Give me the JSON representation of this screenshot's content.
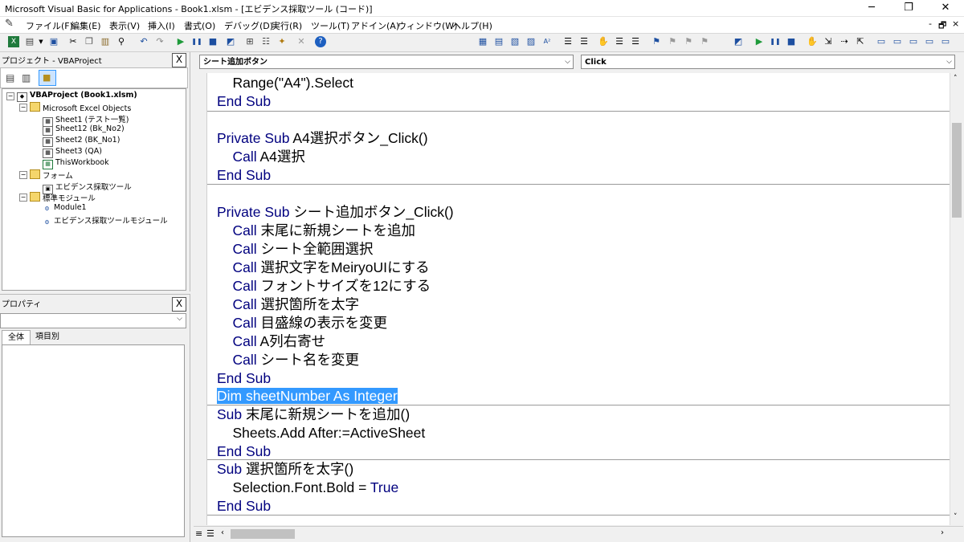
{
  "window": {
    "title": "Microsoft Visual Basic for Applications - Book1.xlsm - [エビデンス採取ツール (コード)]",
    "minimize": "─",
    "maximize": "❐",
    "close": "✕"
  },
  "menu": {
    "items": [
      "ファイル(F)",
      "編集(E)",
      "表示(V)",
      "挿入(I)",
      "書式(O)",
      "デバッグ(D)",
      "実行(R)",
      "ツール(T)",
      "アドイン(A)",
      "ウィンドウ(W)",
      "ヘルプ(H)"
    ],
    "mdi_minimize": "-",
    "mdi_restore": "🗗",
    "mdi_close": "×"
  },
  "project_pane": {
    "title": "プロジェクト - VBAProject",
    "close": "X",
    "tree": [
      {
        "label": "VBAProject (Book1.xlsm)",
        "icon": "vbaproject-icon"
      },
      {
        "label": "Microsoft Excel Objects",
        "icon": "folder-icon"
      },
      {
        "label": "Sheet1 (テスト一覧)",
        "icon": "worksheet-icon"
      },
      {
        "label": "Sheet12 (Bk_No2)",
        "icon": "worksheet-icon"
      },
      {
        "label": "Sheet2 (BK_No1)",
        "icon": "worksheet-icon"
      },
      {
        "label": "Sheet3 (QA)",
        "icon": "worksheet-icon"
      },
      {
        "label": "ThisWorkbook",
        "icon": "workbook-icon"
      },
      {
        "label": "フォーム",
        "icon": "folder-icon"
      },
      {
        "label": "エビデンス採取ツール",
        "icon": "form-icon"
      },
      {
        "label": "標準モジュール",
        "icon": "folder-icon"
      },
      {
        "label": "Module1",
        "icon": "module-icon"
      },
      {
        "label": "エビデンス採取ツールモジュール",
        "icon": "module-icon"
      }
    ]
  },
  "properties_pane": {
    "title": "プロパティ",
    "close": "X",
    "tabs": [
      "全体",
      "項目別"
    ]
  },
  "code_window": {
    "object_combo": "シート追加ボタン",
    "procedure_combo": "Click",
    "lines": [
      {
        "indent": "    ",
        "kw": "",
        "tx": "Range(\"A4\").Select"
      },
      {
        "indent": "",
        "kw": "End Sub",
        "tx": ""
      },
      {
        "indent": "",
        "kw": "",
        "tx": ""
      },
      {
        "indent": "",
        "kw": "Private Sub ",
        "tx": "A4選択ボタン_Click()"
      },
      {
        "indent": "    ",
        "kw": "Call ",
        "tx": "A4選択"
      },
      {
        "indent": "",
        "kw": "End Sub",
        "tx": ""
      },
      {
        "indent": "",
        "kw": "",
        "tx": ""
      },
      {
        "indent": "",
        "kw": "Private Sub ",
        "tx": "シート追加ボタン_Click()"
      },
      {
        "indent": "    ",
        "kw": "Call ",
        "tx": "末尾に新規シートを追加"
      },
      {
        "indent": "    ",
        "kw": "Call ",
        "tx": "シート全範囲選択"
      },
      {
        "indent": "    ",
        "kw": "Call ",
        "tx": "選択文字をMeiryoUIにする"
      },
      {
        "indent": "    ",
        "kw": "Call ",
        "tx": "フォントサイズを12にする"
      },
      {
        "indent": "    ",
        "kw": "Call ",
        "tx": "選択箇所を太字"
      },
      {
        "indent": "    ",
        "kw": "Call ",
        "tx": "目盛線の表示を変更"
      },
      {
        "indent": "    ",
        "kw": "Call ",
        "tx": "A列右寄せ"
      },
      {
        "indent": "    ",
        "kw": "Call ",
        "tx": "シート名を変更"
      },
      {
        "indent": "",
        "kw": "End Sub",
        "tx": ""
      },
      {
        "indent": "",
        "kw": "",
        "tx": "Dim sheetNumber As Integer"
      },
      {
        "indent": "",
        "kw": "Sub ",
        "tx": "末尾に新規シートを追加()"
      },
      {
        "indent": "    ",
        "kw": "",
        "tx": "Sheets.Add After:=ActiveSheet"
      },
      {
        "indent": "",
        "kw": "End Sub",
        "tx": ""
      },
      {
        "indent": "",
        "kw": "Sub ",
        "tx": "選択箇所を太字()"
      },
      {
        "indent": "    ",
        "kw": "",
        "tx": "Selection.Font.Bold = ",
        "kw2": "True"
      },
      {
        "indent": "",
        "kw": "End Sub",
        "tx": ""
      }
    ]
  },
  "colors": {
    "keyword": "#00007f",
    "selection": "#3399ff",
    "separator": "#9a9a9a"
  }
}
